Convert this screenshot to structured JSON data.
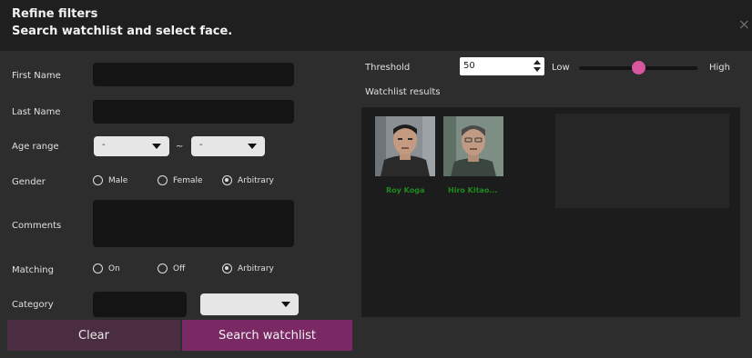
{
  "header": {
    "title_line1": "Refine filters",
    "title_line2": "Search watchlist and select face.",
    "close_glyph": "×"
  },
  "form": {
    "first_name": {
      "label": "First Name",
      "value": ""
    },
    "last_name": {
      "label": "Last Name",
      "value": ""
    },
    "age_range": {
      "label": "Age range",
      "from": "-",
      "to": "-",
      "separator": "~"
    },
    "gender": {
      "label": "Gender",
      "options": [
        "Male",
        "Female",
        "Arbitrary"
      ],
      "selected": "Arbitrary"
    },
    "comments": {
      "label": "Comments",
      "value": ""
    },
    "matching": {
      "label": "Matching",
      "options": [
        "On",
        "Off",
        "Arbitrary"
      ],
      "selected": "Arbitrary"
    },
    "category": {
      "label": "Category",
      "value": "",
      "select_value": ""
    }
  },
  "buttons": {
    "clear": "Clear",
    "search": "Search watchlist"
  },
  "threshold": {
    "label": "Threshold",
    "value": "50",
    "low_label": "Low",
    "high_label": "High",
    "slider_fraction": 0.5
  },
  "results": {
    "label": "Watchlist results",
    "items": [
      {
        "name": "Roy Koga"
      },
      {
        "name": "Hiro Kitao..."
      }
    ]
  },
  "colors": {
    "accent": "#7a2965",
    "clear_button": "#4b2d42",
    "slider_thumb": "#d8569d",
    "result_name": "#1e8a1e"
  },
  "icons": [
    "close-icon",
    "chevron-down-icon",
    "spinner-up-icon",
    "spinner-down-icon"
  ]
}
